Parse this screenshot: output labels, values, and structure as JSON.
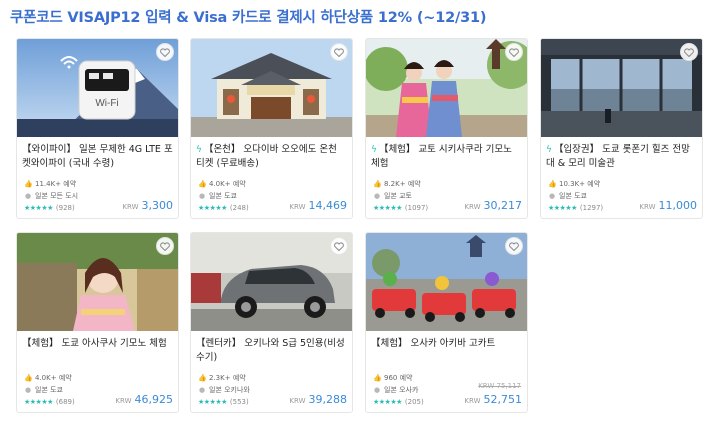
{
  "banner": "쿠폰코드 VISAJP12 입력 & Visa 카드로 결제시 하단상품 12% (~12/31)",
  "colors": {
    "accent": "#3a6fd0",
    "price": "#3a8bd8",
    "rating": "#2cbcb3",
    "instant": "#2cc3b8"
  },
  "icons": {
    "wishlist": "heart-icon",
    "bookings": "thumb-icon",
    "location": "pin-icon",
    "instant": "lightning-icon"
  },
  "cards": [
    {
      "instant": false,
      "title": "【와이파이】 일본 무제한 4G LTE 포켓와이파이 (국내 수령)",
      "bookings": "11.4K+ 예약",
      "location": "일본 모든 도시",
      "stars": "★★★★★",
      "reviews": "(928)",
      "currency": "KRW",
      "price": "3,300",
      "wifi_label": "Wi-Fi"
    },
    {
      "instant": true,
      "title": "【온천】 오다이바 오오에도 온천 티켓 (무료배송)",
      "bookings": "4.0K+ 예약",
      "location": "일본 도쿄",
      "stars": "★★★★★",
      "reviews": "(248)",
      "currency": "KRW",
      "price": "14,469"
    },
    {
      "instant": true,
      "title": "【체험】 교토 시키사쿠라 기모노 체험",
      "bookings": "8.2K+ 예약",
      "location": "일본 교토",
      "stars": "★★★★★",
      "reviews": "(1097)",
      "currency": "KRW",
      "price": "30,217"
    },
    {
      "instant": true,
      "title": "【입장권】 도쿄 롯폰기 힐즈 전망대 & 모리 미술관",
      "bookings": "10.3K+ 예약",
      "location": "일본 도쿄",
      "stars": "★★★★★",
      "reviews": "(1297)",
      "currency": "KRW",
      "price": "11,000"
    },
    {
      "instant": false,
      "title": "【체험】 도쿄 아사쿠사 기모노 체험",
      "bookings": "4.0K+ 예약",
      "location": "일본 도쿄",
      "stars": "★★★★★",
      "reviews": "(689)",
      "currency": "KRW",
      "price": "46,925"
    },
    {
      "instant": false,
      "title": "【렌터카】 오키나와 S급 5인용(비성수기)",
      "bookings": "2.3K+ 예약",
      "location": "일본 오키나와",
      "stars": "★★★★★",
      "reviews": "(553)",
      "currency": "KRW",
      "price": "39,288"
    },
    {
      "instant": false,
      "title": "【체험】 오사카 아키바 고카트",
      "bookings": "960 예약",
      "location": "일본 오사카",
      "stars": "★★★★★",
      "reviews": "(205)",
      "currency": "KRW",
      "price": "52,751",
      "original_price": "KRW 75,117"
    }
  ]
}
